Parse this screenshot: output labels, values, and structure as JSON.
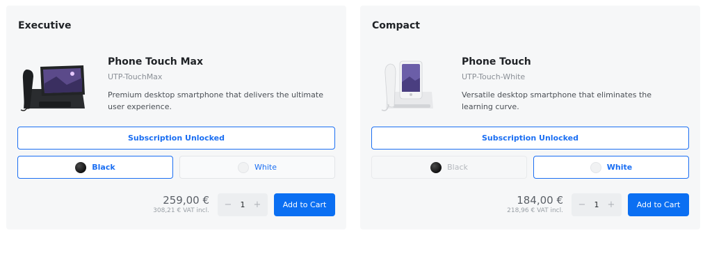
{
  "cards": [
    {
      "title": "Executive",
      "product": {
        "name": "Phone Touch Max",
        "sku": "UTP-TouchMax",
        "description": "Premium desktop smartphone that delivers the ultimate user experience."
      },
      "subscription_label": "Subscription Unlocked",
      "colors": [
        {
          "label": "Black",
          "state": "selected"
        },
        {
          "label": "White",
          "state": "available"
        }
      ],
      "price": "259,00 €",
      "price_vat": "308,21 € VAT incl.",
      "quantity": "1",
      "minus": "−",
      "plus": "+",
      "add_to_cart": "Add to Cart"
    },
    {
      "title": "Compact",
      "product": {
        "name": "Phone Touch",
        "sku": "UTP-Touch-White",
        "description": "Versatile desktop smartphone that eliminates the learning curve."
      },
      "subscription_label": "Subscription Unlocked",
      "colors": [
        {
          "label": "Black",
          "state": "disabled"
        },
        {
          "label": "White",
          "state": "selected"
        }
      ],
      "price": "184,00 €",
      "price_vat": "218,96 € VAT incl.",
      "quantity": "1",
      "minus": "−",
      "plus": "+",
      "add_to_cart": "Add to Cart"
    }
  ],
  "colors": {
    "accent": "#1a6ef2",
    "button": "#0b6ff2",
    "card_bg": "#f6f7f8"
  }
}
